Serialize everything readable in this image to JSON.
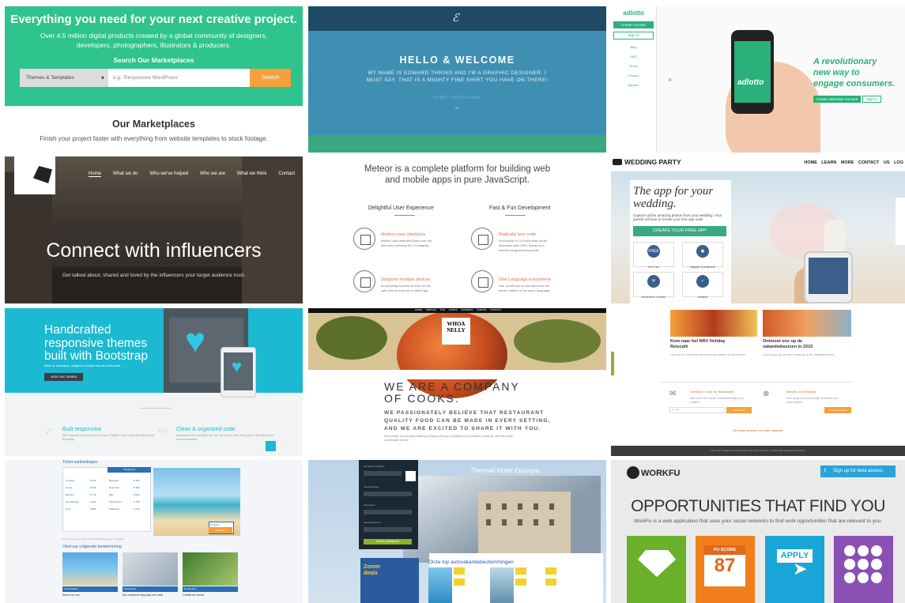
{
  "envato": {
    "headline": "Everything you need for your next creative project.",
    "sub": "Over 4.5 million digital products created by a global community of designers, developers, photographers, illustrators & producers.",
    "search_label": "Search Our Marketplaces",
    "select_value": "Themes & Templates",
    "search_placeholder": "e.g. 'Responsive WordPress'",
    "search_button": "Search",
    "section_title": "Our Marketplaces",
    "section_sub": "Finish your project faster with everything from website templates to stock footage."
  },
  "hello": {
    "logo": "ℰ",
    "title": "HELLO & WELCOME",
    "text": "MY NAME IS EDWARD THRING AND I'M A GRAPHIC DESIGNER. I MUST SAY, THAT IS A MIGHTY FINE SHIRT YOU HAVE ON THERE!",
    "scroll": "START SCROLLING",
    "chevron": "⌄"
  },
  "adlotto": {
    "logo": "adlotto",
    "create_account": "Create Account",
    "sign_in": "Sign In",
    "nav": [
      "Blog",
      "FAQ",
      "Terms",
      "Privacy",
      "Support"
    ],
    "close": "×",
    "phone_logo": "adlotto",
    "tagline_1": "A revolutionary",
    "tagline_2": "new way to",
    "tagline_3": "engage consumers.",
    "btn_advertiser": "Create Advertiser Account",
    "btn_signin": "Sign In"
  },
  "influencers": {
    "nav": [
      "Home",
      "What we do",
      "Who we've helped",
      "Who we are",
      "What we think",
      "Contact"
    ],
    "headline": "Connect with influencers",
    "sub": "Get talked about, shared and loved by the influencers your target audience trust."
  },
  "meteor": {
    "headline": "Meteor is a complete platform for building web and mobile apps in pure JavaScript.",
    "col1": "Delightful User Experience",
    "col2": "Fast & Fun Development",
    "features": [
      {
        "title": "Modern user interfaces",
        "desc": "Meteor uses data that flows over the wire and refreshes the UI instantly."
      },
      {
        "title": "Radically less code",
        "desc": "Accomplish in 10 lines what would otherwise take 1000, thanks to a reactive programming model."
      },
      {
        "title": "Supports multiple devices",
        "desc": "An amazing experience both on the web and as a phone or tablet app."
      },
      {
        "title": "One Language everywhere",
        "desc": "Use JavaScript on the client and the server, written in the same language."
      }
    ]
  },
  "wedding": {
    "logo": "WEDDING PARTY",
    "nav": "HOME  LEARN MORE  CONTACT US  LOG",
    "title_1": "The app for your",
    "title_2": "wedding.",
    "desc": "Capture all the amazing photos from your wedding. Your guests will love it! Create your free app now!",
    "cta": "CREATE YOUR FREE APP",
    "features": [
      {
        "badge": "FREE",
        "label": "It's Free"
      },
      {
        "badge": "▣",
        "label": "Digital Guestbook"
      },
      {
        "badge": "Ψ",
        "label": "Exclusive Guests"
      },
      {
        "badge": "✓",
        "label": "Instant"
      }
    ]
  },
  "bootstrap": {
    "headline_1": "Handcrafted",
    "headline_2": "responsive themes",
    "headline_3": "built with Bootstrap",
    "sub": "Made for developers, designers & people from all of this world.",
    "button": "VIEW OUR THEMES",
    "heart": "♥",
    "f1_title": "Built responsive",
    "f1_desc": "With responsive themes built on top of Twitter's new mobile-first framework, Bootstrap.",
    "f2_title": "Clean & organized code",
    "f2_desc": "Making the most beautiful site from all of your code. Every line is well structured and documented.",
    "f1_icon": "⤢",
    "f2_icon": "</>"
  },
  "whoa": {
    "nav": "HOME  SERVICE  THE COOKS  CATERING EVENTS  CONTACT",
    "logo_1": "WHOA",
    "logo_2": "NELLY",
    "headline_1": "WE ARE A COMPANY",
    "headline_2": "OF COOKS.",
    "sub_1": "WE PASSIONATELY BELIEVE THAT RESTAURANT",
    "sub_2": "QUALITY FOOD CAN BE MADE IN EVERY SETTING,",
    "sub_3": "AND WE ARE EXCITED TO SHARE IT WITH YOU.",
    "body": "Whoa Nelly! is a boutique catering company serving Los Angeles and Southern California. We offer every conceivable service."
  },
  "nrv": {
    "a1_title_1": "Kom naar het NRV Holiday",
    "a1_title_2": "Reiscafé",
    "a2_title_1": "Ontmoet ons op de",
    "a2_title_2": "vakantiebeurzen in 2015",
    "a1_desc": "Laat uw reis ontwerpen door onze specialisten in het reiscafé.",
    "a2_desc": "Ook dit jaar zijn wij weer aanwezig op de vakantiebeurzen.",
    "n1_title": "Schrijf je in voor de nieuwsbrief",
    "n1_desc": "Elke week de leukste reisaanbiedingen in je mailbox.",
    "n1_placeholder": "E-mail",
    "n1_button": "Aanmelden",
    "n2_title": "Bezoek ons Reiscafé",
    "n2_desc": "Kom langs voor persoonlijk reisadvies van onze experts.",
    "n2_button": "Plan een bezoek",
    "links_title": "De beste keuzes voor elke vakantie",
    "footer": "Over NRV  |  Algemene voorwaarden  |  Privacy  |  Contact  |  © 2015 NRV Holiday Powered by",
    "icon1": "✉",
    "icon2": "⊗"
  },
  "travel": {
    "title": "Ticket aanbiedingen",
    "tab": "Vliegtickets",
    "rows": [
      {
        "a": "Curaçao",
        "b": "€ 599",
        "c": "Bangkok",
        "d": "€ 489"
      },
      {
        "a": "Aruba",
        "b": "€ 659",
        "c": "New York",
        "d": "€ 399"
      },
      {
        "a": "Bonaire",
        "b": "€ 749",
        "c": "Bali",
        "d": "€ 699"
      },
      {
        "a": "Sint Maarten",
        "b": "€ 689",
        "c": "Paramaribo",
        "d": "€ 789"
      },
      {
        "a": "Lima",
        "b": "€ 899",
        "c": "Kaapstad",
        "d": "€ 649"
      }
    ],
    "promo_title": "Curaçao",
    "promo_button": "Boek nu",
    "notice": "Prijzen zijn per persoon, inclusief belastingen en toeslagen.",
    "section": "Vind uw volgende bestemming",
    "cards": [
      {
        "badge": "Zonvakanties",
        "title": "Strand en zon"
      },
      {
        "badge": "Stedentrips",
        "title": "Een weekend weg naar een stad"
      },
      {
        "badge": "Rondreizen",
        "title": "Ontdek de wereld"
      }
    ]
  },
  "hotel": {
    "title": "Thermal Hotel Eurospa",
    "form_labels": [
      "Uw aankomstdatum",
      "Aantal nachten",
      "Kamertype",
      "Aantal personen"
    ],
    "form_button": "BEKIJK AANBIEDING",
    "ad_line_1": "Zomer",
    "ad_line_2": "deals",
    "section": "Onze top autovakantiebestemmingen"
  },
  "workfu": {
    "logo": "WORKFU",
    "cta": "Sign up for beta access",
    "twitter": "t",
    "headline": "OPPORTUNITIES THAT FIND YOU",
    "sub": "WorkFu is a web application that uses your social networks to find work opportunities that are relevant to you.",
    "score_label": "FU SCORE",
    "score": "87",
    "apply": "APPLY",
    "cursor": "➤"
  },
  "colors": {
    "envato_green": "#2fc38d",
    "hello_blue": "#3f8fb2",
    "adlotto_green": "#2ab07a",
    "bootstrap_cyan": "#1bb9d2",
    "workfu_orange": "#f07f1c"
  }
}
